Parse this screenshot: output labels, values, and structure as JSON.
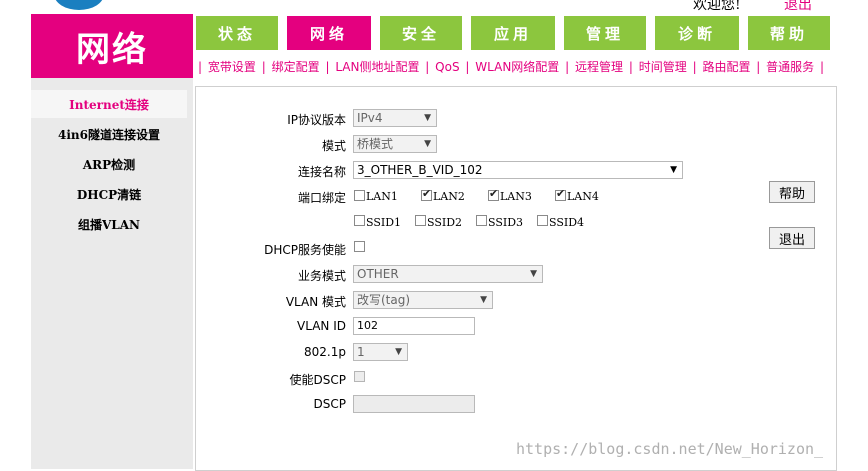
{
  "header": {
    "welcome": "欢迎您!",
    "logout": "退出",
    "brand_title": "网络"
  },
  "main_tabs": [
    {
      "label": "状态",
      "active": false
    },
    {
      "label": "网络",
      "active": true
    },
    {
      "label": "安全",
      "active": false
    },
    {
      "label": "应用",
      "active": false
    },
    {
      "label": "管理",
      "active": false
    },
    {
      "label": "诊断",
      "active": false
    },
    {
      "label": "帮助",
      "active": false
    }
  ],
  "sub_tabs": [
    "宽带设置",
    "绑定配置",
    "LAN侧地址配置",
    "QoS",
    "WLAN网络配置",
    "远程管理",
    "时间管理",
    "路由配置",
    "普通服务"
  ],
  "sidebar": {
    "items": [
      {
        "label": "Internet连接",
        "active": true
      },
      {
        "label": "4in6隧道连接设置",
        "active": false
      },
      {
        "label": "ARP检测",
        "active": false
      },
      {
        "label": "DHCP清链",
        "active": false
      },
      {
        "label": "组播VLAN",
        "active": false
      }
    ]
  },
  "form": {
    "ip_version": {
      "label": "IP协议版本",
      "value": "IPv4"
    },
    "mode": {
      "label": "模式",
      "value": "桥模式"
    },
    "connection_name": {
      "label": "连接名称",
      "value": "3_OTHER_B_VID_102"
    },
    "port_binding": {
      "label": "端口绑定",
      "ports": [
        {
          "label": "LAN1",
          "checked": false
        },
        {
          "label": "LAN2",
          "checked": true
        },
        {
          "label": "LAN3",
          "checked": true
        },
        {
          "label": "LAN4",
          "checked": true
        },
        {
          "label": "SSID1",
          "checked": false
        },
        {
          "label": "SSID2",
          "checked": false
        },
        {
          "label": "SSID3",
          "checked": false
        },
        {
          "label": "SSID4",
          "checked": false
        }
      ]
    },
    "dhcp_server": {
      "label": "DHCP服务使能",
      "checked": false
    },
    "service_mode": {
      "label": "业务模式",
      "value": "OTHER"
    },
    "vlan_mode": {
      "label": "VLAN 模式",
      "value": "改写(tag)"
    },
    "vlan_id": {
      "label": "VLAN ID",
      "value": "102"
    },
    "dot1p": {
      "label": "802.1p",
      "value": "1"
    },
    "enable_dscp": {
      "label": "使能DSCP",
      "checked": false
    },
    "dscp": {
      "label": "DSCP",
      "value": ""
    }
  },
  "buttons": {
    "help": "帮助",
    "exit": "退出"
  },
  "watermark": "https://blog.csdn.net/New_Horizon_"
}
